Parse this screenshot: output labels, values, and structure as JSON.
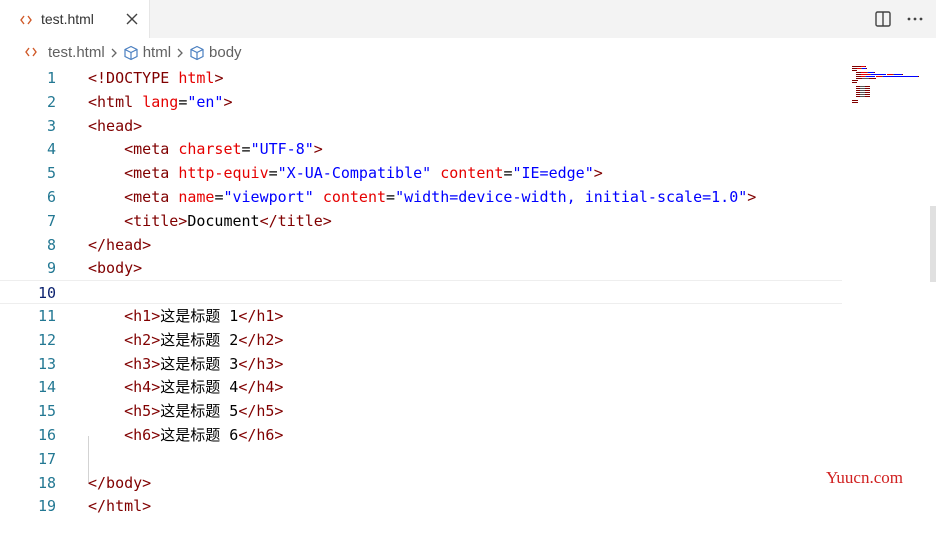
{
  "tab": {
    "label": "test.html",
    "icon": "code-file-icon"
  },
  "actions": {
    "split": "split-editor-icon",
    "more": "more-actions-icon"
  },
  "breadcrumb": {
    "file": "test.html",
    "items": [
      "html",
      "body"
    ]
  },
  "editor": {
    "active_line": 10,
    "lines": [
      {
        "n": "1",
        "parts": [
          {
            "c": "t-doctype",
            "t": "<!DOCTYPE "
          },
          {
            "c": "t-attr",
            "t": "html"
          },
          {
            "c": "t-doctype",
            "t": ">"
          }
        ]
      },
      {
        "n": "2",
        "parts": [
          {
            "c": "t-tag",
            "t": "<html "
          },
          {
            "c": "t-attr",
            "t": "lang"
          },
          {
            "c": "t-text",
            "t": "="
          },
          {
            "c": "t-val",
            "t": "\"en\""
          },
          {
            "c": "t-tag",
            "t": ">"
          }
        ]
      },
      {
        "n": "3",
        "parts": [
          {
            "c": "t-tag",
            "t": "<head>"
          }
        ]
      },
      {
        "n": "4",
        "parts": [
          {
            "c": "t-text",
            "t": "    "
          },
          {
            "c": "t-tag",
            "t": "<meta "
          },
          {
            "c": "t-attr",
            "t": "charset"
          },
          {
            "c": "t-text",
            "t": "="
          },
          {
            "c": "t-val",
            "t": "\"UTF-8\""
          },
          {
            "c": "t-tag",
            "t": ">"
          }
        ]
      },
      {
        "n": "5",
        "parts": [
          {
            "c": "t-text",
            "t": "    "
          },
          {
            "c": "t-tag",
            "t": "<meta "
          },
          {
            "c": "t-attr",
            "t": "http-equiv"
          },
          {
            "c": "t-text",
            "t": "="
          },
          {
            "c": "t-val",
            "t": "\"X-UA-Compatible\""
          },
          {
            "c": "t-text",
            "t": " "
          },
          {
            "c": "t-attr",
            "t": "content"
          },
          {
            "c": "t-text",
            "t": "="
          },
          {
            "c": "t-val",
            "t": "\"IE=edge\""
          },
          {
            "c": "t-tag",
            "t": ">"
          }
        ]
      },
      {
        "n": "6",
        "parts": [
          {
            "c": "t-text",
            "t": "    "
          },
          {
            "c": "t-tag",
            "t": "<meta "
          },
          {
            "c": "t-attr",
            "t": "name"
          },
          {
            "c": "t-text",
            "t": "="
          },
          {
            "c": "t-val",
            "t": "\"viewport\""
          },
          {
            "c": "t-text",
            "t": " "
          },
          {
            "c": "t-attr",
            "t": "content"
          },
          {
            "c": "t-text",
            "t": "="
          },
          {
            "c": "t-val",
            "t": "\"width=device-width, initial-scale=1.0\""
          },
          {
            "c": "t-tag",
            "t": ">"
          }
        ]
      },
      {
        "n": "7",
        "parts": [
          {
            "c": "t-text",
            "t": "    "
          },
          {
            "c": "t-tag",
            "t": "<title>"
          },
          {
            "c": "t-text",
            "t": "Document"
          },
          {
            "c": "t-tag",
            "t": "</title>"
          }
        ]
      },
      {
        "n": "8",
        "parts": [
          {
            "c": "t-tag",
            "t": "</head>"
          }
        ]
      },
      {
        "n": "9",
        "parts": [
          {
            "c": "t-tag",
            "t": "<body>"
          }
        ]
      },
      {
        "n": "10",
        "parts": []
      },
      {
        "n": "11",
        "parts": [
          {
            "c": "t-text",
            "t": "    "
          },
          {
            "c": "t-tag",
            "t": "<h1>"
          },
          {
            "c": "t-text",
            "t": "这是标题 1"
          },
          {
            "c": "t-tag",
            "t": "</h1>"
          }
        ]
      },
      {
        "n": "12",
        "parts": [
          {
            "c": "t-text",
            "t": "    "
          },
          {
            "c": "t-tag",
            "t": "<h2>"
          },
          {
            "c": "t-text",
            "t": "这是标题 2"
          },
          {
            "c": "t-tag",
            "t": "</h2>"
          }
        ]
      },
      {
        "n": "13",
        "parts": [
          {
            "c": "t-text",
            "t": "    "
          },
          {
            "c": "t-tag",
            "t": "<h3>"
          },
          {
            "c": "t-text",
            "t": "这是标题 3"
          },
          {
            "c": "t-tag",
            "t": "</h3>"
          }
        ]
      },
      {
        "n": "14",
        "parts": [
          {
            "c": "t-text",
            "t": "    "
          },
          {
            "c": "t-tag",
            "t": "<h4>"
          },
          {
            "c": "t-text",
            "t": "这是标题 4"
          },
          {
            "c": "t-tag",
            "t": "</h4>"
          }
        ]
      },
      {
        "n": "15",
        "parts": [
          {
            "c": "t-text",
            "t": "    "
          },
          {
            "c": "t-tag",
            "t": "<h5>"
          },
          {
            "c": "t-text",
            "t": "这是标题 5"
          },
          {
            "c": "t-tag",
            "t": "</h5>"
          }
        ]
      },
      {
        "n": "16",
        "parts": [
          {
            "c": "t-text",
            "t": "    "
          },
          {
            "c": "t-tag",
            "t": "<h6>"
          },
          {
            "c": "t-text",
            "t": "这是标题 6"
          },
          {
            "c": "t-tag",
            "t": "</h6>"
          }
        ]
      },
      {
        "n": "17",
        "parts": []
      },
      {
        "n": "18",
        "parts": [
          {
            "c": "t-tag",
            "t": "</body>"
          }
        ]
      },
      {
        "n": "19",
        "parts": [
          {
            "c": "t-tag",
            "t": "</html>"
          }
        ]
      }
    ]
  },
  "watermark": "Yuucn.com",
  "colors": {
    "tag": "#800000",
    "attribute": "#e50000",
    "value": "#0000ff",
    "line_number": "#237893",
    "icon_accent": "#d05a29"
  }
}
